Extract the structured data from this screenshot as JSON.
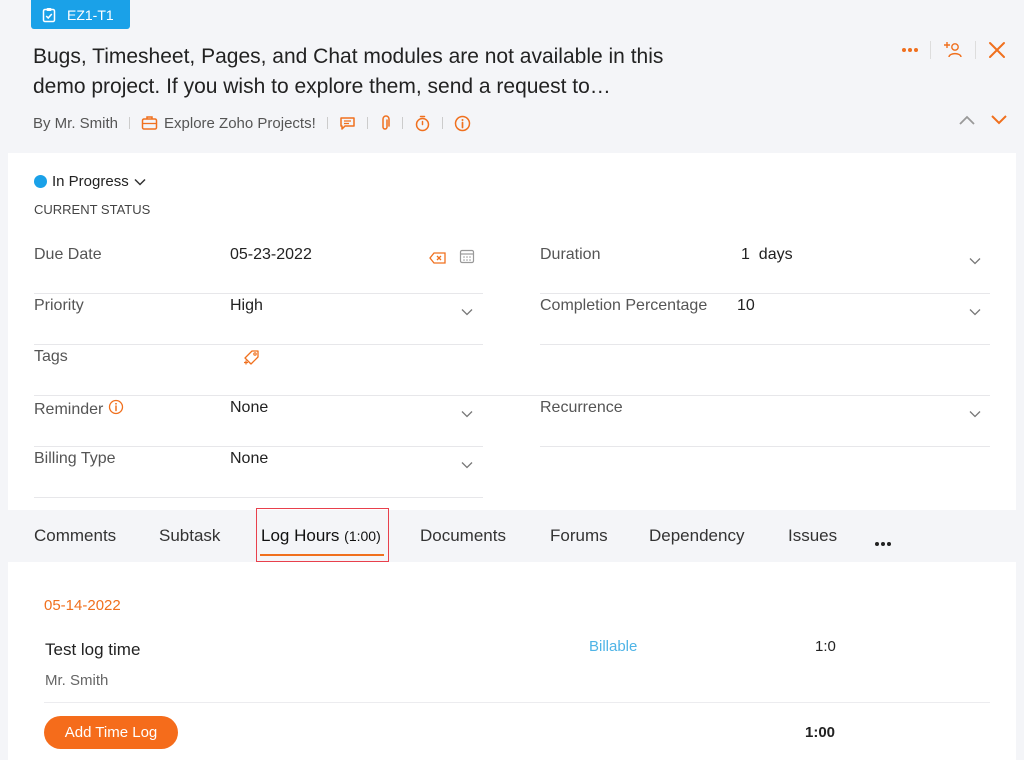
{
  "task": {
    "id": "EZ1-T1",
    "title_line1": "Bugs, Timesheet, Pages, and Chat modules are not available in this",
    "title_line2": "demo project. If you wish to explore them, send a request to…",
    "author": "By Mr. Smith",
    "project": "Explore Zoho Projects!"
  },
  "header_icons": [
    "more-icon",
    "assign-user-icon",
    "close-icon"
  ],
  "meta_icons": [
    "comment-icon",
    "attachment-icon",
    "timer-icon",
    "info-icon"
  ],
  "status": {
    "value": "In Progress",
    "label": "CURRENT STATUS",
    "color": "#1aa1e8"
  },
  "fields": {
    "due_date": {
      "label": "Due Date",
      "value": "05-23-2022"
    },
    "duration": {
      "label": "Duration",
      "value": "1  days"
    },
    "priority": {
      "label": "Priority",
      "value": "High"
    },
    "completion": {
      "label": "Completion Percentage",
      "value": "10"
    },
    "tags": {
      "label": "Tags"
    },
    "reminder": {
      "label": "Reminder",
      "value": "None"
    },
    "recurrence": {
      "label": "Recurrence"
    },
    "billing_type": {
      "label": "Billing Type",
      "value": "None"
    }
  },
  "tabs": [
    {
      "label": "Comments"
    },
    {
      "label": "Subtask"
    },
    {
      "label": "Log Hours",
      "count": "(1:00)"
    },
    {
      "label": "Documents"
    },
    {
      "label": "Forums"
    },
    {
      "label": "Dependency"
    },
    {
      "label": "Issues"
    }
  ],
  "log": {
    "date": "05-14-2022",
    "entry_title": "Test log time",
    "entry_user": "Mr. Smith",
    "billable": "Billable",
    "hours": "1:0",
    "add_button": "Add Time Log",
    "total": "1:00"
  },
  "colors": {
    "accent": "#f0701e",
    "brand_blue": "#1aa1e8",
    "billable": "#4fb4e6"
  }
}
